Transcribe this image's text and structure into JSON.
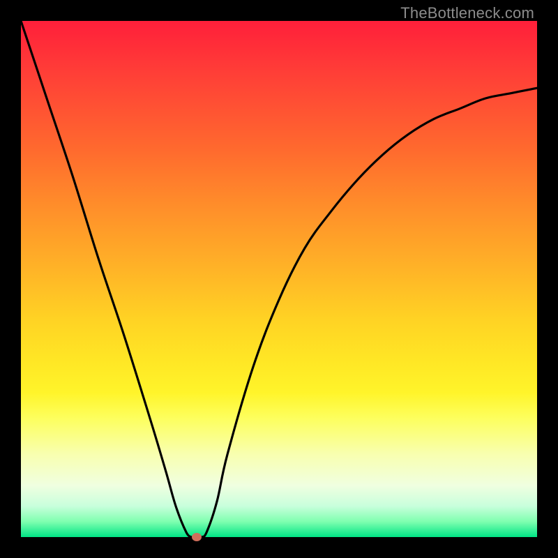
{
  "watermark": "TheBottleneck.com",
  "colors": {
    "frame": "#000000",
    "curve": "#000000",
    "dot": "#cf6e5b",
    "gradient_top": "#ff1f3a",
    "gradient_bottom": "#00e585"
  },
  "chart_data": {
    "type": "line",
    "title": "",
    "xlabel": "",
    "ylabel": "",
    "xlim": [
      0,
      100
    ],
    "ylim": [
      0,
      100
    ],
    "grid": false,
    "legend": false,
    "x": [
      0,
      5,
      10,
      15,
      20,
      25,
      28,
      30,
      32,
      33,
      34,
      35,
      36,
      38,
      40,
      45,
      50,
      55,
      60,
      65,
      70,
      75,
      80,
      85,
      90,
      95,
      100
    ],
    "values": [
      100,
      85,
      70,
      54,
      39,
      23,
      13,
      6,
      1,
      0,
      0,
      0,
      1,
      7,
      16,
      33,
      46,
      56,
      63,
      69,
      74,
      78,
      81,
      83,
      85,
      86,
      87
    ],
    "marker": {
      "x": 34,
      "y": 0
    },
    "annotations": []
  }
}
